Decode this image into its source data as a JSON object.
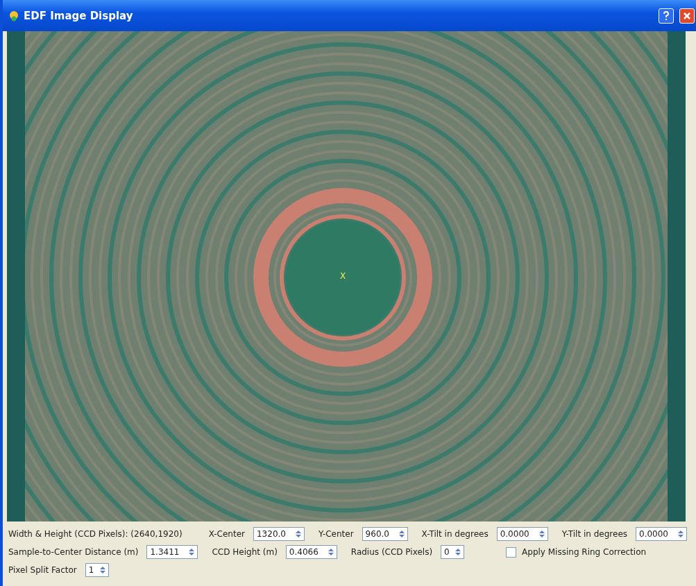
{
  "window": {
    "title": "EDF Image Display"
  },
  "image": {
    "center_marker": "X"
  },
  "controls": [
    {
      "kind": "text",
      "label": "Width & Height (CCD Pixels): (2640,1920)"
    },
    {
      "kind": "spin",
      "label": "X-Center",
      "value": "1320.0"
    },
    {
      "kind": "spin",
      "label": "Y-Center",
      "value": "960.0"
    },
    {
      "kind": "spin",
      "label": "X-Tilt in degrees",
      "value": "0.0000"
    },
    {
      "kind": "spin",
      "label": "Y-Tilt in degrees",
      "value": "0.0000"
    },
    {
      "kind": "break"
    },
    {
      "kind": "spin",
      "label": "Sample-to-Center Distance (m)",
      "value": "1.3411"
    },
    {
      "kind": "spin",
      "label": "CCD Height (m)",
      "value": "0.4066"
    },
    {
      "kind": "spin",
      "label": "Radius (CCD Pixels)",
      "value": "0"
    },
    {
      "kind": "check",
      "label": "Apply Missing Ring Correction",
      "checked": false
    },
    {
      "kind": "break"
    },
    {
      "kind": "spin",
      "label": "Pixel Split Factor",
      "value": "1"
    }
  ]
}
